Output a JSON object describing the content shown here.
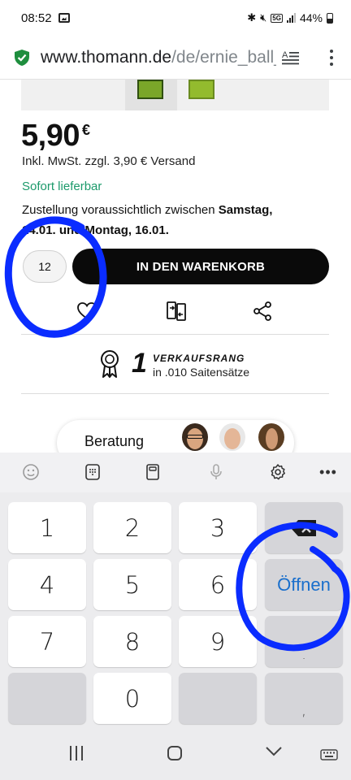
{
  "status_bar": {
    "time": "08:52",
    "network": "5G",
    "battery": "44%"
  },
  "browser": {
    "url_host": "www.thomann.de",
    "url_path": "/de/ernie_ball_"
  },
  "product": {
    "price_value": "5,90",
    "price_currency": "€",
    "vat_note": "Inkl. MwSt. zzgl. 3,90 € Versand",
    "availability": "Sofort lieferbar",
    "delivery_prefix": "Zustellung voraussichtlich zwischen ",
    "delivery_start": "Samstag,",
    "delivery_middle": "14.01. und ",
    "delivery_end": "Montag, 16.01.",
    "quantity": "12",
    "add_to_cart_label": "IN DEN WARENKORB"
  },
  "rank": {
    "number": "1",
    "title": "VERKAUFSRANG",
    "subtitle": "in .010 Saitensätze"
  },
  "advice": {
    "label": "Beratung"
  },
  "keyboard": {
    "keys": [
      "1",
      "2",
      "3",
      "4",
      "5",
      "6",
      "7",
      "8",
      "9",
      "0"
    ],
    "action_label": "Öffnen",
    "dot_label": ".",
    "comma_label": ","
  },
  "colors": {
    "availability_green": "#1c9a6b",
    "cart_button": "#0a0a0a",
    "keyboard_action_blue": "#1a6fcc",
    "annotation_blue": "#0a2cff",
    "secure_shield": "#1e8e3e"
  }
}
